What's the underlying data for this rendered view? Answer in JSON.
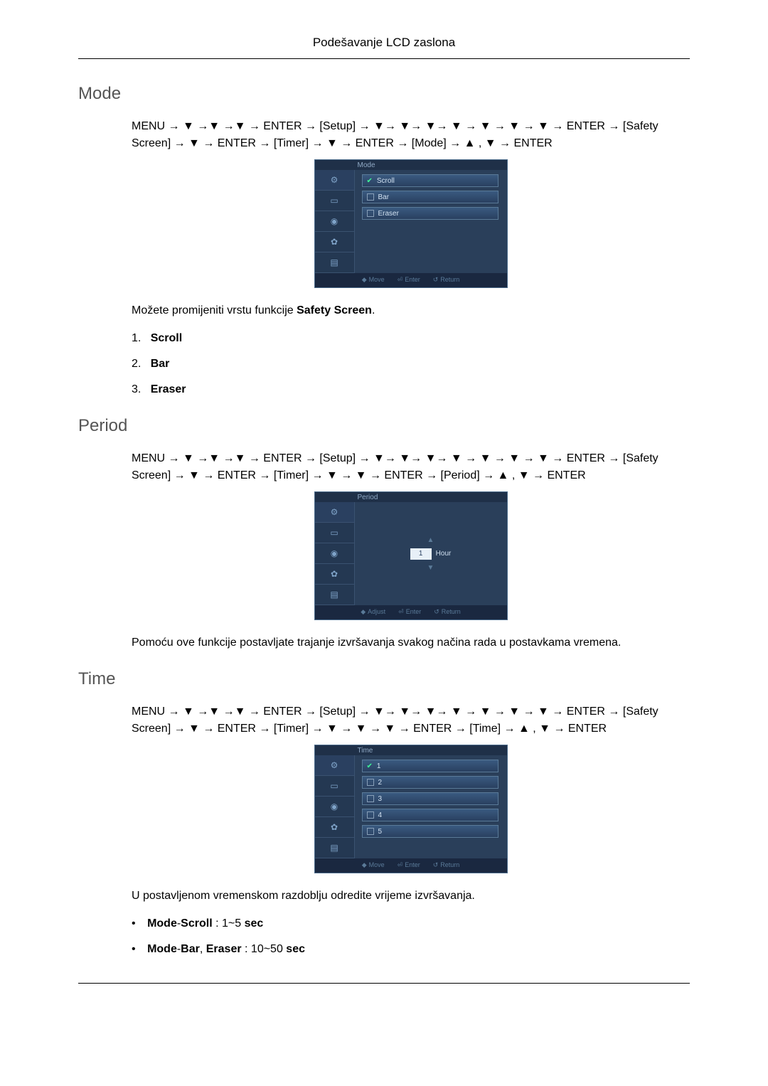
{
  "header": "Podešavanje LCD zaslona",
  "glyphs": {
    "down": "▼",
    "up": "▲",
    "arrow": "→"
  },
  "sections": {
    "mode": {
      "heading": "Mode",
      "nav": "MENU → ▼ →▼ →▼ → ENTER → [Setup] → ▼→ ▼→ ▼→ ▼ → ▼ → ▼ → ▼ → ENTER → [Safety Screen] → ▼ → ENTER → [Timer] → ▼ → ENTER → [Mode] → ▲ , ▼ → ENTER",
      "osd": {
        "title": "Mode",
        "sidebar_icons": [
          "picture-icon",
          "pip-icon",
          "o-icon",
          "gear-icon",
          "info-icon"
        ],
        "options": [
          {
            "label": "Scroll",
            "selected": true
          },
          {
            "label": "Bar",
            "selected": false
          },
          {
            "label": "Eraser",
            "selected": false
          }
        ],
        "footer": {
          "move": "Move",
          "enter": "Enter",
          "return": "Return"
        }
      },
      "body_text_prefix": "Možete promijeniti vrstu funkcije ",
      "body_text_bold": "Safety Screen",
      "body_text_suffix": ".",
      "list": [
        "Scroll",
        "Bar",
        "Eraser"
      ],
      "list_label_1": "1.",
      "list_label_2": "2.",
      "list_label_3": "3."
    },
    "period": {
      "heading": "Period",
      "nav": "MENU → ▼ →▼ →▼ → ENTER → [Setup] → ▼→ ▼→ ▼→ ▼ → ▼ → ▼ → ▼ → ENTER → [Safety Screen] → ▼ → ENTER → [Timer] → ▼ → ▼ → ENTER → [Period] → ▲ , ▼ → ENTER",
      "osd": {
        "title": "Period",
        "sidebar_icons": [
          "picture-icon",
          "pip-icon",
          "o-icon",
          "gear-icon",
          "info-icon"
        ],
        "value": "1",
        "unit": "Hour",
        "footer": {
          "adjust": "Adjust",
          "enter": "Enter",
          "return": "Return"
        }
      },
      "body_text": "Pomoću ove funkcije postavljate trajanje izvršavanja svakog načina rada u postavkama vremena."
    },
    "time": {
      "heading": "Time",
      "nav": "MENU → ▼ →▼ →▼ → ENTER → [Setup] → ▼→ ▼→ ▼→ ▼ → ▼ → ▼ → ▼ → ENTER → [Safety Screen] → ▼ → ENTER → [Timer] → ▼ → ▼ → ▼ → ENTER → [Time] → ▲ , ▼ → ENTER",
      "osd": {
        "title": "Time",
        "sidebar_icons": [
          "picture-icon",
          "pip-icon",
          "o-icon",
          "gear-icon",
          "info-icon"
        ],
        "options": [
          {
            "label": "1",
            "selected": true
          },
          {
            "label": "2",
            "selected": false
          },
          {
            "label": "3",
            "selected": false
          },
          {
            "label": "4",
            "selected": false
          },
          {
            "label": "5",
            "selected": false
          }
        ],
        "footer": {
          "move": "Move",
          "enter": "Enter",
          "return": "Return"
        }
      },
      "body_text": "U postavljenom vremenskom razdoblju odredite vrijeme izvršavanja.",
      "bullets": [
        {
          "bold": "Mode",
          "dash": "-",
          "bold2": "Scroll",
          "rest": " : 1~5 ",
          "bold3": "sec"
        },
        {
          "bold": "Mode",
          "dash": "-",
          "bold2": "Bar",
          "comma": ", ",
          "bold2b": "Eraser",
          "rest": " : 10~50 ",
          "bold3": "sec"
        }
      ]
    }
  }
}
